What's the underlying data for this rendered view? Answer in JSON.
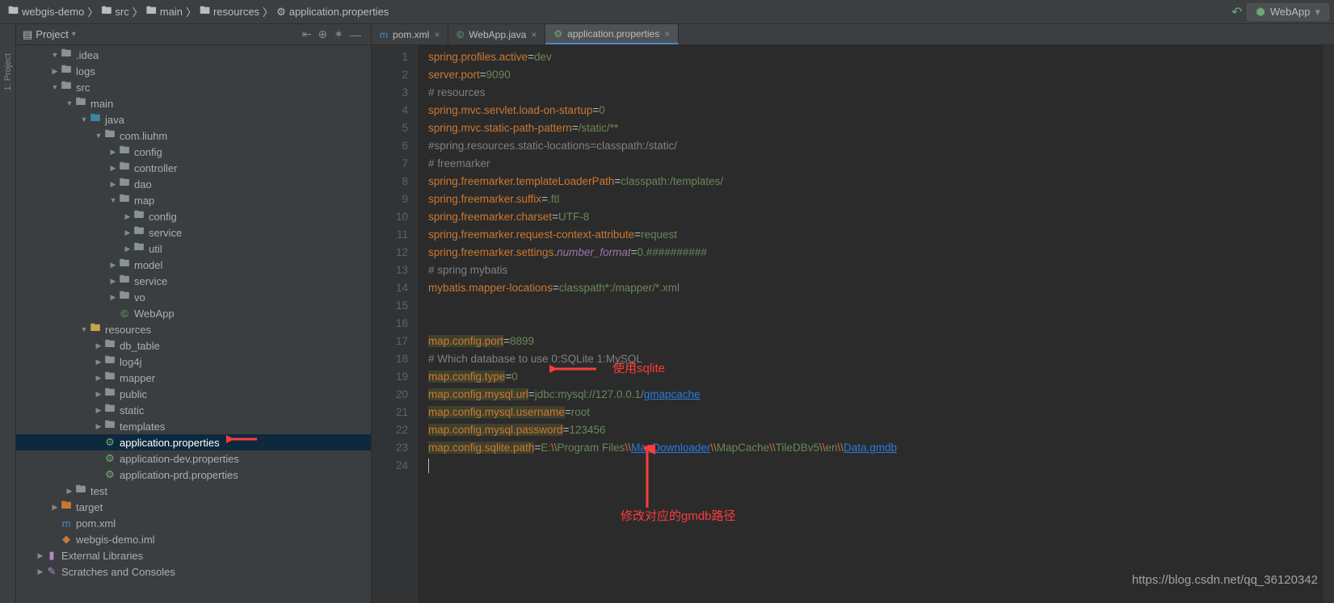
{
  "breadcrumb": [
    "webgis-demo",
    "src",
    "main",
    "resources",
    "application.properties"
  ],
  "run_config": "WebApp",
  "project_panel": {
    "title": "Project"
  },
  "tree": [
    {
      "d": 1,
      "e": "▼",
      "i": "folder",
      "t": ".idea"
    },
    {
      "d": 1,
      "e": "▶",
      "i": "folder",
      "t": "logs"
    },
    {
      "d": 1,
      "e": "▼",
      "i": "folder",
      "t": "src"
    },
    {
      "d": 2,
      "e": "▼",
      "i": "folder",
      "t": "main"
    },
    {
      "d": 3,
      "e": "▼",
      "i": "folder-src",
      "t": "java"
    },
    {
      "d": 4,
      "e": "▼",
      "i": "folder",
      "t": "com.liuhm"
    },
    {
      "d": 5,
      "e": "▶",
      "i": "folder",
      "t": "config"
    },
    {
      "d": 5,
      "e": "▶",
      "i": "folder",
      "t": "controller"
    },
    {
      "d": 5,
      "e": "▶",
      "i": "folder",
      "t": "dao"
    },
    {
      "d": 5,
      "e": "▼",
      "i": "folder",
      "t": "map"
    },
    {
      "d": 6,
      "e": "▶",
      "i": "folder",
      "t": "config"
    },
    {
      "d": 6,
      "e": "▶",
      "i": "folder",
      "t": "service"
    },
    {
      "d": 6,
      "e": "▶",
      "i": "folder",
      "t": "util"
    },
    {
      "d": 5,
      "e": "▶",
      "i": "folder",
      "t": "model"
    },
    {
      "d": 5,
      "e": "▶",
      "i": "folder",
      "t": "service"
    },
    {
      "d": 5,
      "e": "▶",
      "i": "folder",
      "t": "vo"
    },
    {
      "d": 5,
      "e": "",
      "i": "class",
      "t": "WebApp"
    },
    {
      "d": 3,
      "e": "▼",
      "i": "folder-res",
      "t": "resources"
    },
    {
      "d": 4,
      "e": "▶",
      "i": "folder",
      "t": "db_table"
    },
    {
      "d": 4,
      "e": "▶",
      "i": "folder",
      "t": "log4j"
    },
    {
      "d": 4,
      "e": "▶",
      "i": "folder",
      "t": "mapper"
    },
    {
      "d": 4,
      "e": "▶",
      "i": "folder",
      "t": "public"
    },
    {
      "d": 4,
      "e": "▶",
      "i": "folder",
      "t": "static"
    },
    {
      "d": 4,
      "e": "▶",
      "i": "folder",
      "t": "templates"
    },
    {
      "d": 4,
      "e": "",
      "i": "props",
      "t": "application.properties",
      "sel": true
    },
    {
      "d": 4,
      "e": "",
      "i": "props",
      "t": "application-dev.properties"
    },
    {
      "d": 4,
      "e": "",
      "i": "props",
      "t": "application-prd.properties"
    },
    {
      "d": 2,
      "e": "▶",
      "i": "folder",
      "t": "test"
    },
    {
      "d": 1,
      "e": "▶",
      "i": "folder-target",
      "t": "target"
    },
    {
      "d": 1,
      "e": "",
      "i": "pom",
      "t": "pom.xml"
    },
    {
      "d": 1,
      "e": "",
      "i": "iml",
      "t": "webgis-demo.iml"
    },
    {
      "d": 0,
      "e": "▶",
      "i": "lib",
      "t": "External Libraries"
    },
    {
      "d": 0,
      "e": "▶",
      "i": "scratch",
      "t": "Scratches and Consoles"
    }
  ],
  "tabs": [
    {
      "icon": "pom",
      "label": "pom.xml",
      "active": false
    },
    {
      "icon": "class",
      "label": "WebApp.java",
      "active": false
    },
    {
      "icon": "props",
      "label": "application.properties",
      "active": true
    }
  ],
  "lines": [
    {
      "n": 1,
      "seg": [
        [
          "k",
          "spring.profiles.active"
        ],
        [
          "eq",
          "="
        ],
        [
          "v",
          "dev"
        ]
      ]
    },
    {
      "n": 2,
      "seg": [
        [
          "k",
          "server.port"
        ],
        [
          "eq",
          "="
        ],
        [
          "v",
          "9090"
        ]
      ]
    },
    {
      "n": 3,
      "seg": [
        [
          "c",
          "# resources"
        ]
      ]
    },
    {
      "n": 4,
      "seg": [
        [
          "k",
          "spring.mvc.servlet.load-on-startup"
        ],
        [
          "eq",
          "="
        ],
        [
          "v",
          "0"
        ]
      ]
    },
    {
      "n": 5,
      "seg": [
        [
          "k",
          "spring.mvc.static-path-pattern"
        ],
        [
          "eq",
          "="
        ],
        [
          "v",
          "/static/**"
        ]
      ]
    },
    {
      "n": 6,
      "seg": [
        [
          "c",
          "#spring.resources.static-locations=classpath:/static/"
        ]
      ]
    },
    {
      "n": 7,
      "seg": [
        [
          "c",
          "# freemarker"
        ]
      ]
    },
    {
      "n": 8,
      "seg": [
        [
          "k",
          "spring.freemarker.templateLoaderPath"
        ],
        [
          "eq",
          "="
        ],
        [
          "v",
          "classpath:/templates/"
        ]
      ]
    },
    {
      "n": 9,
      "seg": [
        [
          "k",
          "spring.freemarker.suffix"
        ],
        [
          "eq",
          "="
        ],
        [
          "v",
          ".ftl"
        ]
      ]
    },
    {
      "n": 10,
      "seg": [
        [
          "k",
          "spring.freemarker.charset"
        ],
        [
          "eq",
          "="
        ],
        [
          "v",
          "UTF-8"
        ]
      ]
    },
    {
      "n": 11,
      "seg": [
        [
          "k",
          "spring.freemarker.request-context-attribute"
        ],
        [
          "eq",
          "="
        ],
        [
          "v",
          "request"
        ]
      ]
    },
    {
      "n": 12,
      "seg": [
        [
          "k",
          "spring.freemarker.settings."
        ],
        [
          "it",
          "number_format"
        ],
        [
          "eq",
          "="
        ],
        [
          "v",
          "0.##########"
        ]
      ]
    },
    {
      "n": 13,
      "seg": [
        [
          "c",
          "# spring mybatis"
        ]
      ]
    },
    {
      "n": 14,
      "seg": [
        [
          "k",
          "mybatis.mapper-locations"
        ],
        [
          "eq",
          "="
        ],
        [
          "v",
          "classpath*:/mapper/*.xml"
        ]
      ]
    },
    {
      "n": 15,
      "seg": []
    },
    {
      "n": 16,
      "seg": []
    },
    {
      "n": 17,
      "seg": [
        [
          "k hl",
          "map.config.port"
        ],
        [
          "eq",
          "="
        ],
        [
          "v",
          "8899"
        ]
      ]
    },
    {
      "n": 18,
      "seg": [
        [
          "c",
          "# Which database to use 0:SQLite 1:MySQL"
        ]
      ]
    },
    {
      "n": 19,
      "seg": [
        [
          "k hl",
          "map.config.type"
        ],
        [
          "eq",
          "="
        ],
        [
          "v",
          "0"
        ]
      ]
    },
    {
      "n": 20,
      "seg": [
        [
          "k hl",
          "map.config.mysql.url"
        ],
        [
          "eq",
          "="
        ],
        [
          "v",
          "jdbc:mysql://127.0.0.1/"
        ],
        [
          "url",
          "gmapcache"
        ]
      ]
    },
    {
      "n": 21,
      "seg": [
        [
          "k hl",
          "map.config.mysql.username"
        ],
        [
          "eq",
          "="
        ],
        [
          "v",
          "root"
        ]
      ]
    },
    {
      "n": 22,
      "seg": [
        [
          "k hl",
          "map.config.mysql.password"
        ],
        [
          "eq",
          "="
        ],
        [
          "v",
          "123456"
        ]
      ]
    },
    {
      "n": 23,
      "seg": [
        [
          "k hl",
          "map.config.sqlite.path"
        ],
        [
          "eq",
          "="
        ],
        [
          "v",
          "E:"
        ],
        [
          "escaped",
          "\\\\"
        ],
        [
          "v",
          "Program Files"
        ],
        [
          "escaped",
          "\\\\"
        ],
        [
          "url",
          "MapDownloader"
        ],
        [
          "escaped",
          "\\\\"
        ],
        [
          "v",
          "MapCache"
        ],
        [
          "escaped",
          "\\\\"
        ],
        [
          "v",
          "TileDBv5"
        ],
        [
          "escaped",
          "\\\\"
        ],
        [
          "v",
          "en"
        ],
        [
          "escaped",
          "\\\\"
        ],
        [
          "url",
          "Data.gmdb"
        ]
      ]
    },
    {
      "n": 24,
      "seg": []
    }
  ],
  "annotations": {
    "a1": "使用sqlite",
    "a2": "修改对应的gmdb路径",
    "watermark": "https://blog.csdn.net/qq_36120342"
  },
  "sidetab": "1: Project",
  "icons": {
    "folder": "🖿",
    "folder-src": "🖿",
    "folder-res": "🖿",
    "folder-target": "🖿",
    "class": "©",
    "props": "⚙",
    "pom": "m",
    "iml": "◆",
    "lib": "▮",
    "scratch": "✎"
  }
}
